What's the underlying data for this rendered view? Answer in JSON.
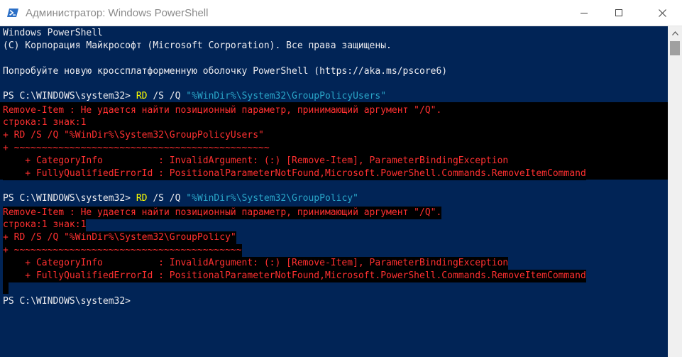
{
  "window": {
    "title": "Администратор: Windows PowerShell"
  },
  "icons": {
    "app": "powershell-icon",
    "minimize": "minimize-icon",
    "maximize": "maximize-icon",
    "close": "close-icon",
    "scroll_up": "chevron-up-icon"
  },
  "colors": {
    "console_background": "#012456",
    "console_text": "#eeedf0",
    "error_text": "#ff3030",
    "error_background": "#000000",
    "command": "#ffff00",
    "string": "#2aa6c9"
  },
  "console": {
    "header_line1": "Windows PowerShell",
    "header_line2": "(C) Корпорация Майкрософт (Microsoft Corporation). Все права защищены.",
    "header_line3": "Попробуйте новую кроссплатформенную оболочку PowerShell (https://aka.ms/pscore6)",
    "prompt": "PS C:\\WINDOWS\\system32> ",
    "block1": {
      "command": "RD",
      "params": " /S /Q ",
      "argument": "\"%WinDir%\\System32\\GroupPolicyUsers\"",
      "errors": [
        "Remove-Item : Не удается найти позиционный параметр, принимающий аргумент \"/Q\".",
        "строка:1 знак:1",
        "+ RD /S /Q \"%WinDir%\\System32\\GroupPolicyUsers\"",
        "+ ~~~~~~~~~~~~~~~~~~~~~~~~~~~~~~~~~~~~~~~~~~~~~~",
        "    + CategoryInfo          : InvalidArgument: (:) [Remove-Item], ParameterBindingException",
        "    + FullyQualifiedErrorId : PositionalParameterNotFound,Microsoft.PowerShell.Commands.RemoveItemCommand"
      ]
    },
    "block2": {
      "command": "RD",
      "params": " /S /Q ",
      "argument": "\"%WinDir%\\System32\\GroupPolicy\"",
      "errors": [
        "Remove-Item : Не удается найти позиционный параметр, принимающий аргумент \"/Q\".",
        "строка:1 знак:1",
        "+ RD /S /Q \"%WinDir%\\System32\\GroupPolicy\"",
        "+ ~~~~~~~~~~~~~~~~~~~~~~~~~~~~~~~~~~~~~~~~~",
        "    + CategoryInfo          : InvalidArgument: (:) [Remove-Item], ParameterBindingException",
        "    + FullyQualifiedErrorId : PositionalParameterNotFound,Microsoft.PowerShell.Commands.RemoveItemCommand"
      ]
    },
    "final_prompt": "PS C:\\WINDOWS\\system32>"
  }
}
